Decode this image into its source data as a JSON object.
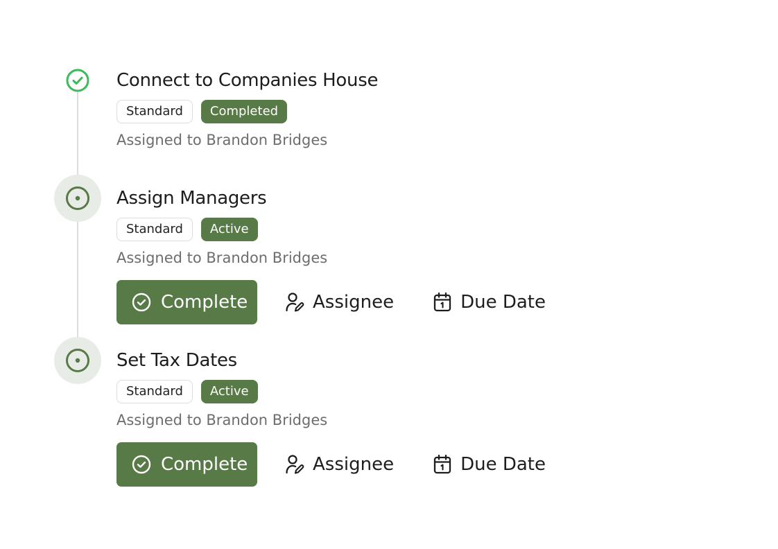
{
  "tasks": [
    {
      "title": "Connect to Companies House",
      "type_badge": "Standard",
      "status_badge": "Completed",
      "assigned": "Assigned to Brandon Bridges",
      "state": "completed"
    },
    {
      "title": "Assign Managers",
      "type_badge": "Standard",
      "status_badge": "Active",
      "assigned": "Assigned to Brandon Bridges",
      "state": "active",
      "actions": {
        "complete_label": "Complete",
        "assignee_label": "Assignee",
        "due_date_label": "Due Date"
      }
    },
    {
      "title": "Set Tax Dates",
      "type_badge": "Standard",
      "status_badge": "Active",
      "assigned": "Assigned to Brandon Bridges",
      "state": "active",
      "actions": {
        "complete_label": "Complete",
        "assignee_label": "Assignee",
        "due_date_label": "Due Date"
      }
    }
  ],
  "icons": {
    "completed_marker": "check-circle-icon",
    "active_marker": "dot-circle-icon",
    "complete_button": "check-circle-icon",
    "assignee_button": "user-edit-icon",
    "due_date_button": "calendar-icon"
  },
  "colors": {
    "accent": "#587a47",
    "completed_check": "#3cb95a",
    "active_ring": "#587a47",
    "active_halo": "#e8ece6",
    "rail": "#dedede",
    "muted_text": "#6d6d6d"
  }
}
